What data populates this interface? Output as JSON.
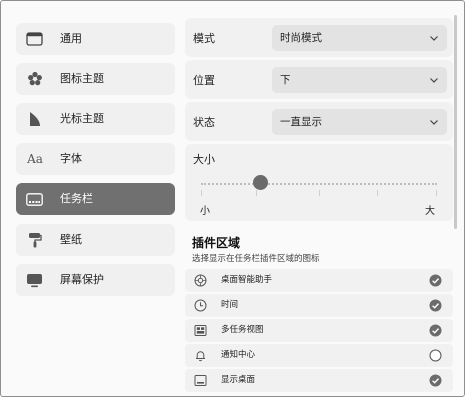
{
  "sidebar": {
    "items": [
      {
        "label": "通用",
        "icon": "window-icon"
      },
      {
        "label": "图标主题",
        "icon": "flower-icon"
      },
      {
        "label": "光标主题",
        "icon": "cursor-icon"
      },
      {
        "label": "字体",
        "icon": "font-icon",
        "icon_text": "Aa"
      },
      {
        "label": "任务栏",
        "icon": "taskbar-icon",
        "active": true
      },
      {
        "label": "壁纸",
        "icon": "paint-roller-icon"
      },
      {
        "label": "屏幕保护",
        "icon": "monitor-icon"
      }
    ]
  },
  "settings": {
    "mode": {
      "label": "模式",
      "value": "时尚模式"
    },
    "position": {
      "label": "位置",
      "value": "下"
    },
    "state": {
      "label": "状态",
      "value": "一直显示"
    },
    "size": {
      "label": "大小",
      "min_label": "小",
      "max_label": "大",
      "level": 0.25
    }
  },
  "plugins": {
    "title": "插件区域",
    "subtitle": "选择显示在任务栏插件区域的图标",
    "items": [
      {
        "label": "桌面智能助手",
        "icon": "assistant-icon",
        "checked": true
      },
      {
        "label": "时间",
        "icon": "clock-icon",
        "checked": true
      },
      {
        "label": "多任务视图",
        "icon": "multitask-icon",
        "checked": true
      },
      {
        "label": "通知中心",
        "icon": "bell-icon",
        "checked": false
      },
      {
        "label": "显示桌面",
        "icon": "desktop-icon",
        "checked": true
      }
    ]
  },
  "colors": {
    "active_item": "#707070",
    "panel": "#f1f1f1",
    "select": "#e3e3e3",
    "check": "#6b6b6b"
  }
}
